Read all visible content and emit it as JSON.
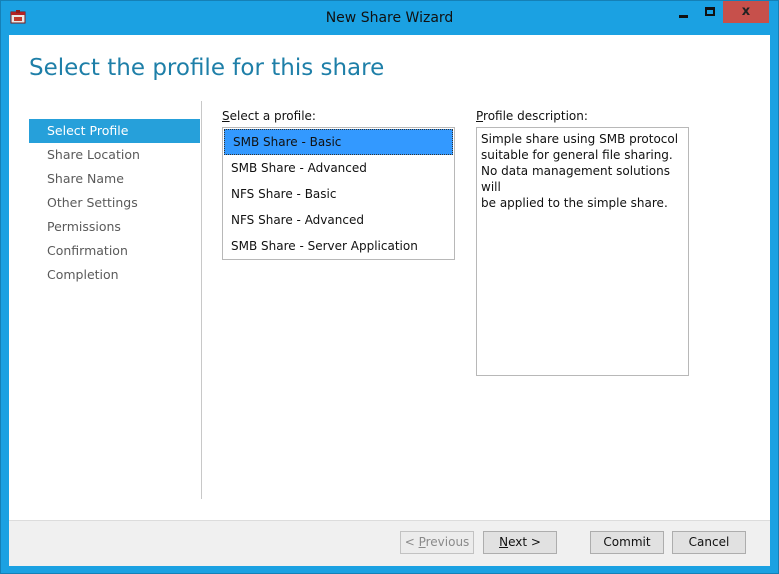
{
  "window": {
    "title": "New Share Wizard",
    "controls": {
      "minimize": "minimize",
      "maximize": "maximize",
      "close": "x"
    }
  },
  "header": {
    "title": "Select the profile for this share"
  },
  "nav": {
    "items": [
      {
        "label": "Select Profile",
        "active": true
      },
      {
        "label": "Share Location"
      },
      {
        "label": "Share Name"
      },
      {
        "label": "Other Settings"
      },
      {
        "label": "Permissions"
      },
      {
        "label": "Confirmation"
      },
      {
        "label": "Completion"
      }
    ]
  },
  "profiles": {
    "label_accel": "S",
    "label_rest": "elect a profile:",
    "items": [
      {
        "label": "SMB Share - Basic",
        "selected": true
      },
      {
        "label": "SMB Share - Advanced"
      },
      {
        "label": "NFS Share - Basic"
      },
      {
        "label": "NFS Share - Advanced"
      },
      {
        "label": "SMB Share - Server Application"
      }
    ]
  },
  "description": {
    "label_accel": "P",
    "label_rest": "rofile description:",
    "lines": [
      "Simple share using SMB protocol",
      "suitable for general file sharing.",
      "No data management solutions will",
      "be applied to the simple share."
    ]
  },
  "footer": {
    "previous_prefix": "< ",
    "previous_accel": "P",
    "previous_rest": "revious",
    "next_accel": "N",
    "next_rest": "ext >",
    "commit": "Commit",
    "cancel": "Cancel"
  },
  "colors": {
    "titlebar": "#1ba1e2",
    "nav_active": "#26a0da",
    "selection": "#3399ff",
    "close_button": "#c7504b",
    "header_text": "#1e7fa8"
  }
}
